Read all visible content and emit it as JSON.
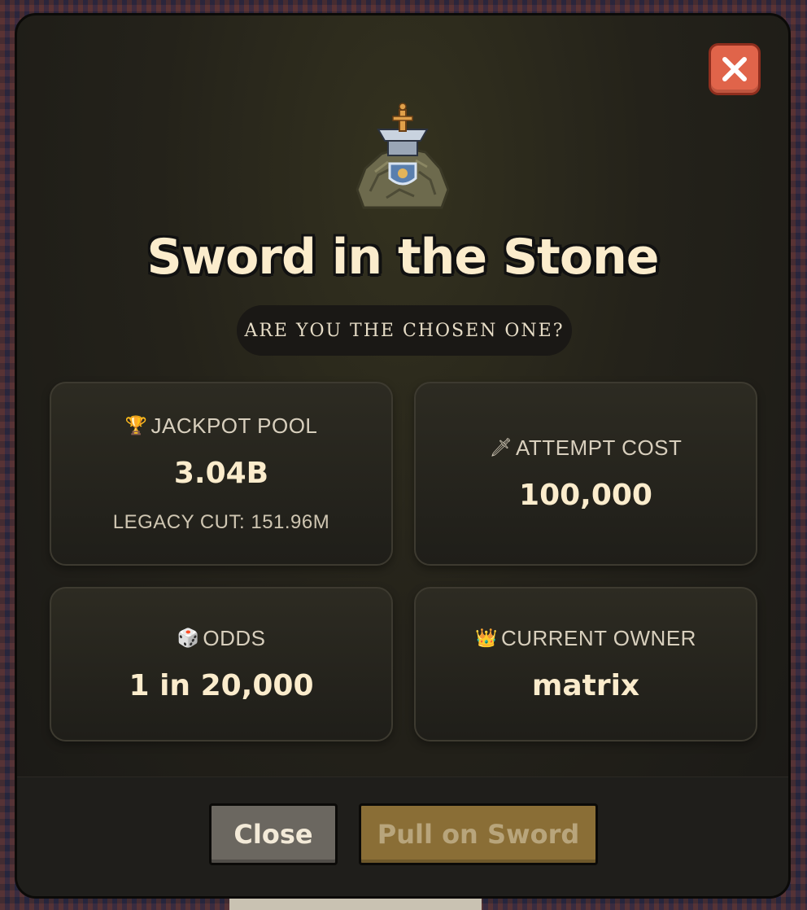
{
  "dialog": {
    "title": "Sword in the Stone",
    "subtitle": "ARE YOU THE CHOSEN ONE?",
    "close_icon": "close-icon"
  },
  "stats": {
    "jackpot": {
      "icon": "🏆",
      "label": "JACKPOT POOL",
      "value": "3.04B",
      "sub": "LEGACY CUT: 151.96M"
    },
    "attempt_cost": {
      "icon": "🗡",
      "label": "ATTEMPT COST",
      "value": "100,000"
    },
    "odds": {
      "icon": "🎲",
      "label": "ODDS",
      "value": "1 in 20,000"
    },
    "owner": {
      "icon": "👑",
      "label": "CURRENT OWNER",
      "value": "matrix"
    }
  },
  "footer": {
    "close_label": "Close",
    "pull_label": "Pull on Sword"
  },
  "colors": {
    "accent_close": "#e0644a",
    "title_text": "#fbeccc",
    "pull_button": "#8a6e36"
  }
}
